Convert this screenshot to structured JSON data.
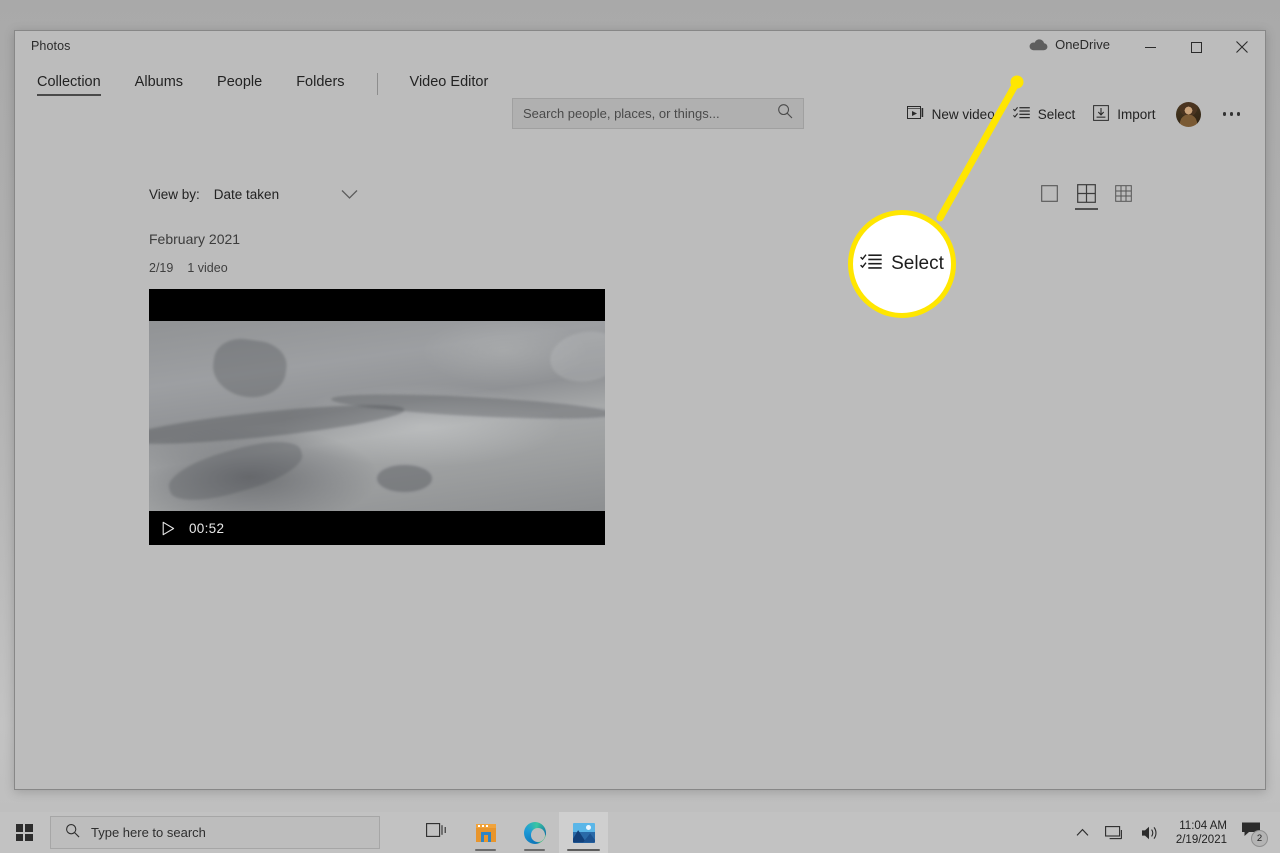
{
  "window": {
    "title": "Photos",
    "onedrive_label": "OneDrive",
    "cloud_icon": "cloud-icon",
    "minimize_icon": "minimize-icon",
    "maximize_icon": "maximize-icon",
    "close_icon": "close-icon"
  },
  "nav": {
    "tabs": [
      {
        "label": "Collection",
        "active": true
      },
      {
        "label": "Albums",
        "active": false
      },
      {
        "label": "People",
        "active": false
      },
      {
        "label": "Folders",
        "active": false
      }
    ],
    "secondary": {
      "label": "Video Editor"
    }
  },
  "search": {
    "placeholder": "Search people, places, or things...",
    "value": "",
    "icon": "search-icon"
  },
  "commands": [
    {
      "label": "New video",
      "icon": "new-video-icon"
    },
    {
      "label": "Select",
      "icon": "select-icon"
    },
    {
      "label": "Import",
      "icon": "import-icon"
    }
  ],
  "account": {
    "avatar": "user-avatar",
    "more_label": "..."
  },
  "toolbar": {
    "view_by_label": "View by:",
    "view_by_value": "Date taken",
    "chevron_icon": "chevron-down-icon",
    "view_modes": [
      {
        "name": "single-view",
        "selected": false
      },
      {
        "name": "medium-grid-view",
        "selected": true
      },
      {
        "name": "small-grid-view",
        "selected": false
      }
    ]
  },
  "gallery": {
    "group_title": "February 2021",
    "group_date": "2/19",
    "group_count": "1 video",
    "items": [
      {
        "type": "video",
        "duration": "00:52",
        "play_icon": "play-icon",
        "alt": "snowy mountain landscape video thumbnail"
      }
    ]
  },
  "callout": {
    "label": "Select",
    "icon": "select-icon",
    "highlight_color": "#ffe600"
  },
  "taskbar": {
    "start_label": "Start",
    "search_placeholder": "Type here to search",
    "search_icon": "search-icon",
    "task_view_icon": "task-view-icon",
    "apps": [
      {
        "name": "microsoft-store",
        "running": true,
        "active": false
      },
      {
        "name": "microsoft-edge",
        "running": true,
        "active": false
      },
      {
        "name": "photos",
        "running": true,
        "active": true
      }
    ],
    "tray": {
      "show_hidden_icon": "chevron-up-icon",
      "network_icon": "network-icon",
      "volume_icon": "volume-icon",
      "time": "11:04 AM",
      "date": "2/19/2021",
      "notifications_icon": "notifications-icon",
      "notifications_count": "2"
    }
  }
}
